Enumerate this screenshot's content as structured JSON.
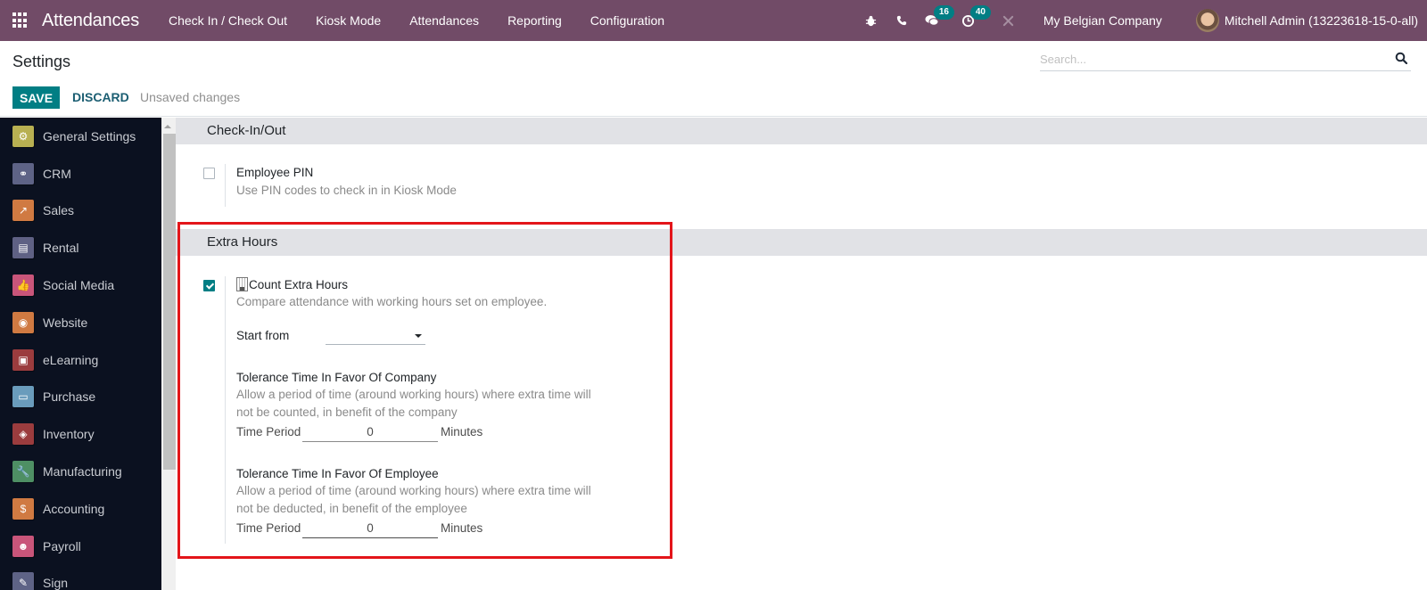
{
  "navbar": {
    "app_name": "Attendances",
    "menu": [
      {
        "label": "Check In / Check Out"
      },
      {
        "label": "Kiosk Mode"
      },
      {
        "label": "Attendances"
      },
      {
        "label": "Reporting"
      },
      {
        "label": "Configuration"
      }
    ],
    "systray": {
      "debug_icon": "bug-icon",
      "phone_icon": "phone-icon",
      "messages_count": "16",
      "activities_count": "40",
      "tools_icon": "tools-icon"
    },
    "company": "My Belgian Company",
    "user": "Mitchell Admin (13223618-15-0-all)"
  },
  "control_panel": {
    "title": "Settings",
    "save_label": "SAVE",
    "discard_label": "DISCARD",
    "status": "Unsaved changes",
    "search_placeholder": "Search..."
  },
  "sidebar": {
    "items": [
      {
        "label": "General Settings",
        "color": "#b8b052",
        "glyph": "⚙"
      },
      {
        "label": "CRM",
        "color": "#5e6386",
        "glyph": "⚭"
      },
      {
        "label": "Sales",
        "color": "#d07a42",
        "glyph": "↗"
      },
      {
        "label": "Rental",
        "color": "#5f6184",
        "glyph": "▤"
      },
      {
        "label": "Social Media",
        "color": "#c9557a",
        "glyph": "👍"
      },
      {
        "label": "Website",
        "color": "#d07a42",
        "glyph": "◉"
      },
      {
        "label": "eLearning",
        "color": "#9b3c3e",
        "glyph": "▣"
      },
      {
        "label": "Purchase",
        "color": "#6a9cbc",
        "glyph": "▭"
      },
      {
        "label": "Inventory",
        "color": "#9b3c3e",
        "glyph": "◈"
      },
      {
        "label": "Manufacturing",
        "color": "#4e8f64",
        "glyph": "🔧"
      },
      {
        "label": "Accounting",
        "color": "#d07a42",
        "glyph": "$"
      },
      {
        "label": "Payroll",
        "color": "#c9557a",
        "glyph": "☻"
      },
      {
        "label": "Sign",
        "color": "#5e6386",
        "glyph": "✎"
      }
    ]
  },
  "main": {
    "sections": [
      {
        "title": "Check-In/Out",
        "settings": [
          {
            "label": "Employee PIN",
            "description": "Use PIN codes to check in in Kiosk Mode",
            "checked": false
          }
        ]
      },
      {
        "title": "Extra Hours",
        "settings": [
          {
            "label": "Count Extra Hours",
            "description": "Compare attendance with working hours set on employee.",
            "checked": true,
            "start_from_label": "Start from",
            "start_from_value": "",
            "company_tolerance": {
              "title": "Tolerance Time In Favor Of Company",
              "desc_line1": "Allow a period of time (around working hours) where extra time will",
              "desc_line2": "not be counted, in benefit of the company",
              "period_label": "Time Period",
              "value": "0",
              "unit": "Minutes"
            },
            "employee_tolerance": {
              "title": "Tolerance Time In Favor Of Employee",
              "desc_line1": "Allow a period of time (around working hours) where extra time will",
              "desc_line2": "not be deducted, in benefit of the employee",
              "period_label": "Time Period",
              "value": "0",
              "unit": "Minutes"
            }
          }
        ]
      }
    ]
  },
  "colors": {
    "navbar": "#714b67",
    "primary": "#017e84",
    "sidebar": "#0b1120",
    "highlight": "#e3151a"
  }
}
